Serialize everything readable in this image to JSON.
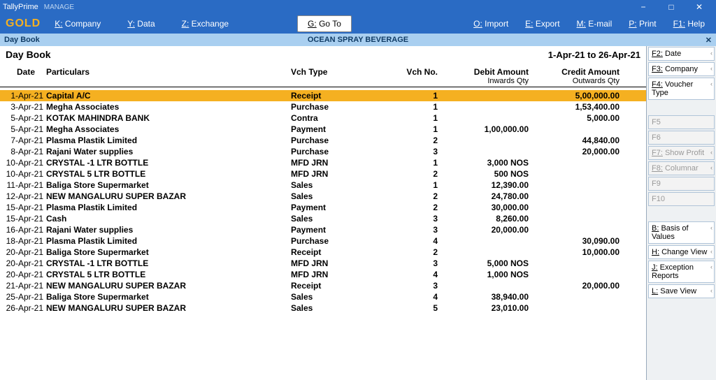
{
  "titlebar": {
    "app": "TallyPrime",
    "manage": "MANAGE"
  },
  "gold": "GOLD",
  "menu": {
    "company": "Company",
    "ck": "K:",
    "data": "Data",
    "dk": "Y:",
    "exchange": "Exchange",
    "ek": "Z:",
    "goto": "Go To",
    "gk": "G:",
    "import": "Import",
    "ik": "O:",
    "export": "Export",
    "xk": "E:",
    "email": "E-mail",
    "mk": "M:",
    "print": "Print",
    "pk": "P:",
    "help": "Help",
    "hk": "F1:"
  },
  "crumb": {
    "left": "Day Book",
    "center": "OCEAN SPRAY BEVERAGE"
  },
  "heading": {
    "title": "Day Book",
    "period": "1-Apr-21 to 26-Apr-21"
  },
  "cols": {
    "date": "Date",
    "particulars": "Particulars",
    "vtype": "Vch Type",
    "vno": "Vch No.",
    "debit": "Debit Amount",
    "credit": "Credit Amount",
    "inq": "Inwards Qty",
    "outq": "Outwards Qty"
  },
  "rows": [
    {
      "date": "1-Apr-21",
      "part": "Capital A/C",
      "vtype": "Receipt",
      "vno": "1",
      "debit": "",
      "credit": "5,00,000.00",
      "sel": true
    },
    {
      "date": "3-Apr-21",
      "part": "Megha Associates",
      "vtype": "Purchase",
      "vno": "1",
      "debit": "",
      "credit": "1,53,400.00"
    },
    {
      "date": "5-Apr-21",
      "part": "KOTAK MAHINDRA BANK",
      "vtype": "Contra",
      "vno": "1",
      "debit": "",
      "credit": "5,000.00"
    },
    {
      "date": "5-Apr-21",
      "part": "Megha Associates",
      "vtype": "Payment",
      "vno": "1",
      "debit": "1,00,000.00",
      "credit": ""
    },
    {
      "date": "7-Apr-21",
      "part": "Plasma Plastik Limited",
      "vtype": "Purchase",
      "vno": "2",
      "debit": "",
      "credit": "44,840.00"
    },
    {
      "date": "8-Apr-21",
      "part": "Rajani Water supplies",
      "vtype": "Purchase",
      "vno": "3",
      "debit": "",
      "credit": "20,000.00"
    },
    {
      "date": "10-Apr-21",
      "part": "CRYSTAL -1 LTR BOTTLE",
      "vtype": "MFD JRN",
      "vno": "1",
      "debit": "3,000 NOS",
      "credit": ""
    },
    {
      "date": "10-Apr-21",
      "part": "CRYSTAL 5 LTR BOTTLE",
      "vtype": "MFD JRN",
      "vno": "2",
      "debit": "500 NOS",
      "credit": ""
    },
    {
      "date": "11-Apr-21",
      "part": "Baliga Store Supermarket",
      "vtype": "Sales",
      "vno": "1",
      "debit": "12,390.00",
      "credit": ""
    },
    {
      "date": "12-Apr-21",
      "part": "NEW MANGALURU SUPER BAZAR",
      "vtype": "Sales",
      "vno": "2",
      "debit": "24,780.00",
      "credit": ""
    },
    {
      "date": "15-Apr-21",
      "part": "Plasma Plastik Limited",
      "vtype": "Payment",
      "vno": "2",
      "debit": "30,000.00",
      "credit": ""
    },
    {
      "date": "15-Apr-21",
      "part": "Cash",
      "vtype": "Sales",
      "vno": "3",
      "debit": "8,260.00",
      "credit": ""
    },
    {
      "date": "16-Apr-21",
      "part": "Rajani Water supplies",
      "vtype": "Payment",
      "vno": "3",
      "debit": "20,000.00",
      "credit": ""
    },
    {
      "date": "18-Apr-21",
      "part": "Plasma Plastik Limited",
      "vtype": "Purchase",
      "vno": "4",
      "debit": "",
      "credit": "30,090.00"
    },
    {
      "date": "20-Apr-21",
      "part": "Baliga Store Supermarket",
      "vtype": "Receipt",
      "vno": "2",
      "debit": "",
      "credit": "10,000.00"
    },
    {
      "date": "20-Apr-21",
      "part": "CRYSTAL -1 LTR BOTTLE",
      "vtype": "MFD JRN",
      "vno": "3",
      "debit": "5,000 NOS",
      "credit": ""
    },
    {
      "date": "20-Apr-21",
      "part": "CRYSTAL 5 LTR BOTTLE",
      "vtype": "MFD JRN",
      "vno": "4",
      "debit": "1,000 NOS",
      "credit": ""
    },
    {
      "date": "21-Apr-21",
      "part": "NEW MANGALURU SUPER BAZAR",
      "vtype": "Receipt",
      "vno": "3",
      "debit": "",
      "credit": "20,000.00"
    },
    {
      "date": "25-Apr-21",
      "part": "Baliga Store Supermarket",
      "vtype": "Sales",
      "vno": "4",
      "debit": "38,940.00",
      "credit": ""
    },
    {
      "date": "26-Apr-21",
      "part": "NEW MANGALURU SUPER BAZAR",
      "vtype": "Sales",
      "vno": "5",
      "debit": "23,010.00",
      "credit": ""
    }
  ],
  "side": {
    "f2": "Date",
    "f2k": "F2:",
    "f3": "Company",
    "f3k": "F3:",
    "f4": "Voucher Type",
    "f4k": "F4:",
    "f5": "F5",
    "f6": "F6",
    "f7": "Show Profit",
    "f7k": "F7:",
    "f8": "Columnar",
    "f8k": "F8:",
    "f9": "F9",
    "f10": "F10",
    "b": "Basis of Values",
    "bk": "B:",
    "h": "Change View",
    "hk": "H:",
    "j": "Exception Reports",
    "jk": "J:",
    "l": "Save View",
    "lk": "L:"
  }
}
